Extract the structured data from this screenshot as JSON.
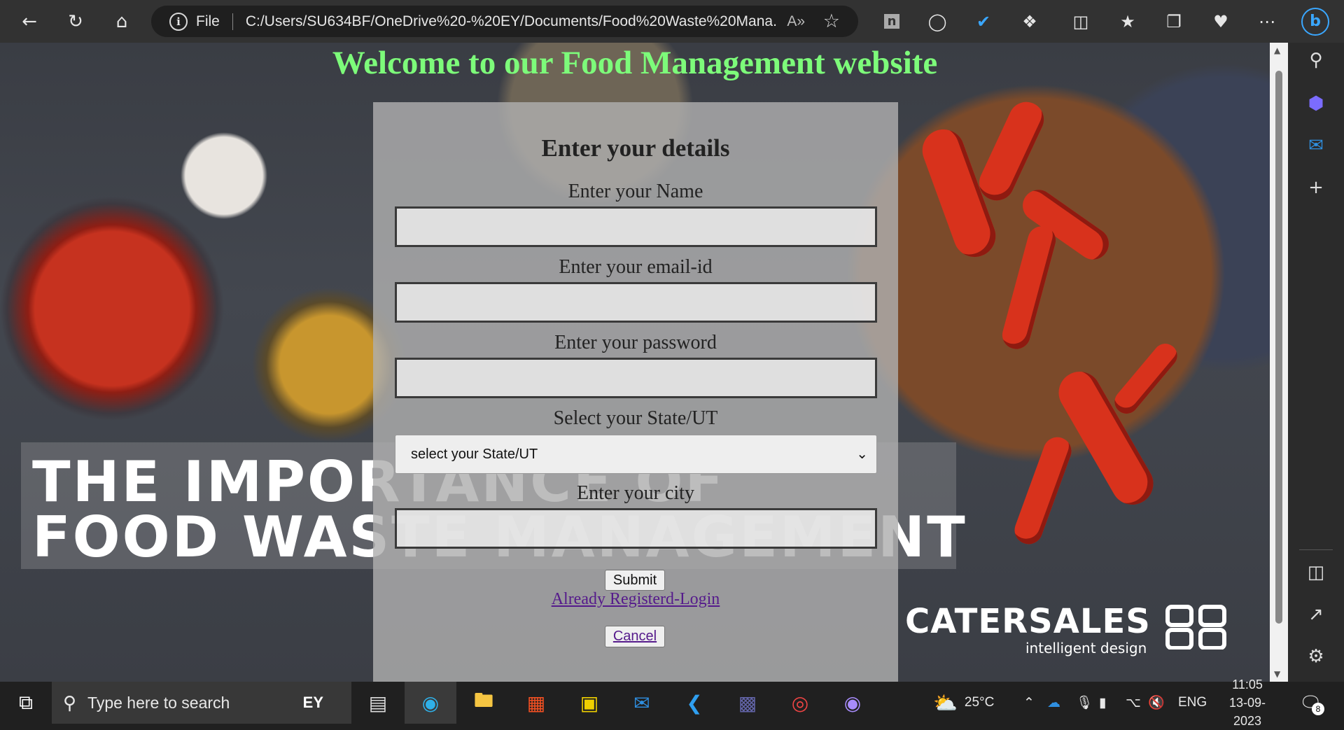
{
  "browser": {
    "address_file_label": "File",
    "url": "C:/Users/SU634BF/OneDrive%20-%20EY/Documents/Food%20Waste%20Mana...",
    "read_aloud_label": "A»"
  },
  "page": {
    "title": "Welcome to our Food Management website",
    "banner_line1": "THE IMPORTANCE OF",
    "banner_line2": "FOOD WASTE MANAGEMENT",
    "logo_name": "CATERSALES",
    "logo_tagline": "intelligent design"
  },
  "form": {
    "heading": "Enter your details",
    "name_label": "Enter your Name",
    "email_label": "Enter your email-id",
    "password_label": "Enter your password",
    "state_label": "Select your State/UT",
    "state_selected": "select your State/UT",
    "city_label": "Enter your city",
    "submit_label": "Submit",
    "login_link": "Already Registerd-Login",
    "cancel_label": "Cancel"
  },
  "taskbar": {
    "search_placeholder": "Type here to search",
    "weather": "25°C",
    "language": "ENG",
    "time": "11:05",
    "date": "13-09-2023",
    "notifications": "8"
  }
}
